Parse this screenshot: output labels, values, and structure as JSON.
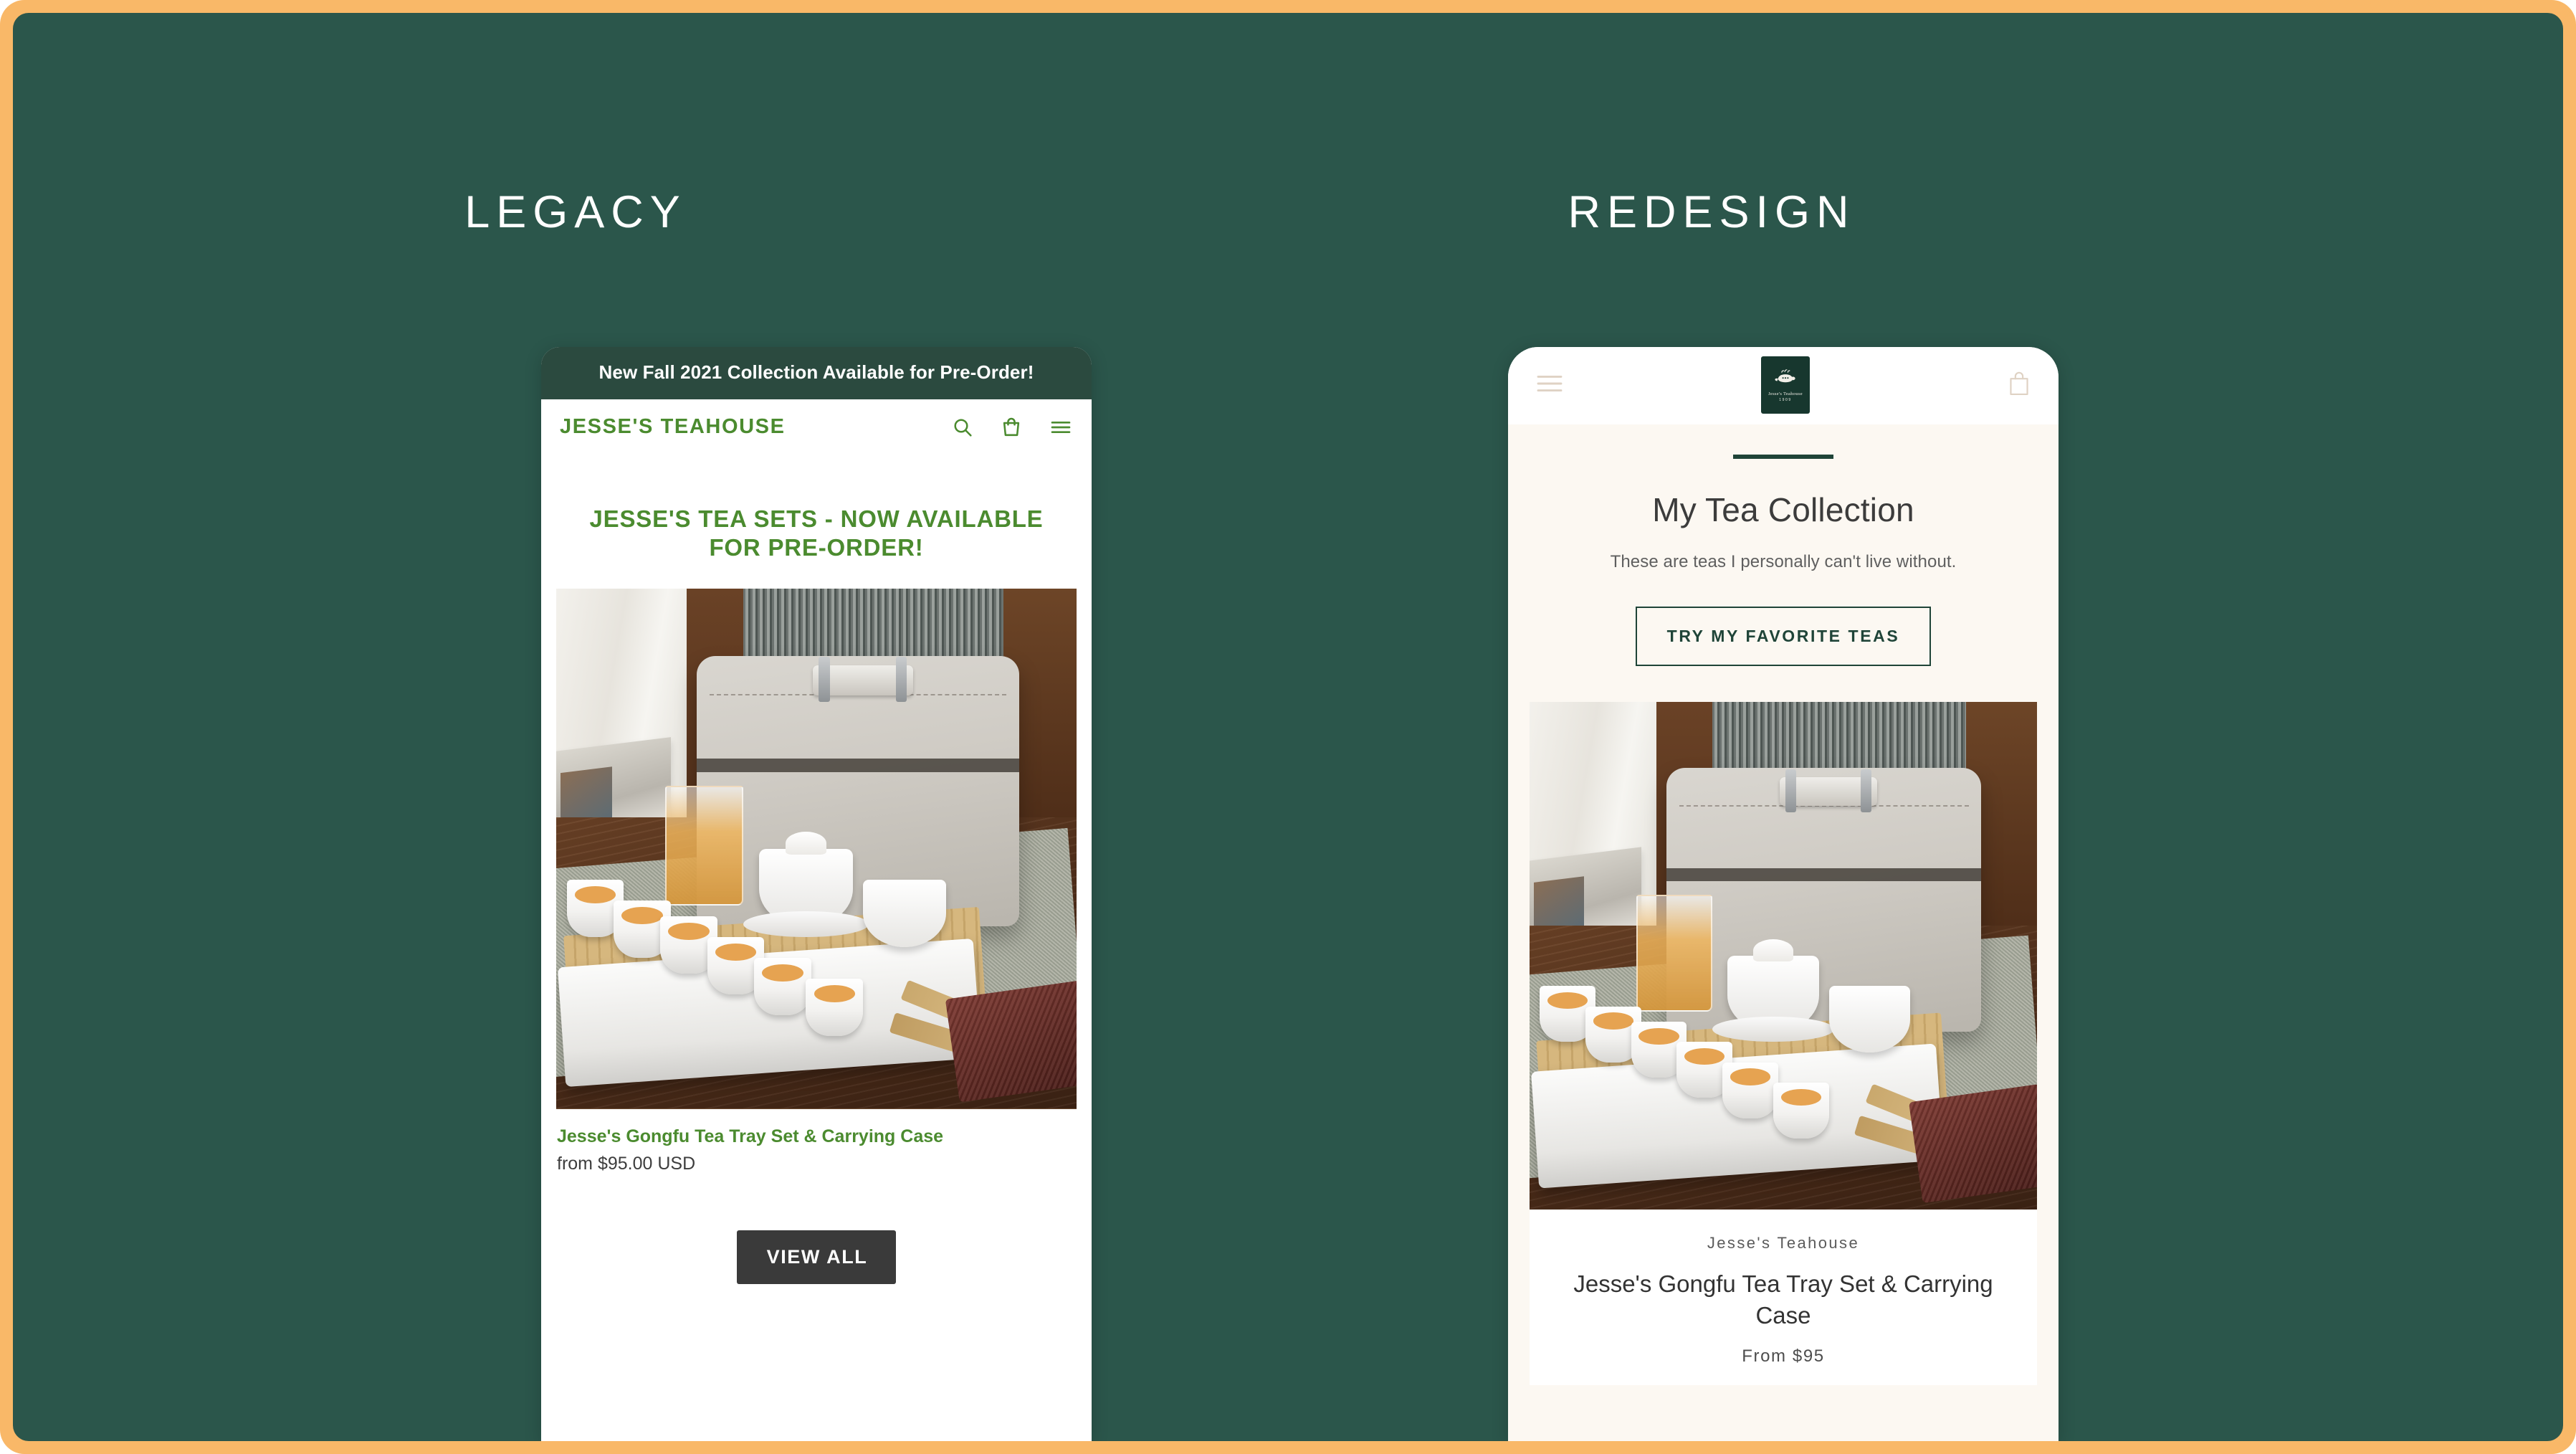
{
  "theme": {
    "frame_orange": "#f9b868",
    "stage_green": "#2b564b",
    "legacy_green": "#4b8b2f",
    "legacy_banner_green": "#2b4a3f",
    "redesign_green": "#1f4438",
    "redesign_cream": "#fcf8f2",
    "redesign_tan": "#dfd2c4"
  },
  "columns": {
    "legacy_label": "LEGACY",
    "redesign_label": "REDESIGN"
  },
  "legacy": {
    "announcement_bar": "New Fall 2021 Collection Available for Pre-Order!",
    "logo": "JESSE'S TEAHOUSE",
    "icons": [
      "search-icon",
      "shopping-bag-icon",
      "hamburger-menu-icon"
    ],
    "hero_heading": "JESSE'S TEA SETS - NOW AVAILABLE FOR PRE-ORDER!",
    "product": {
      "title": "Jesse's Gongfu Tea Tray Set & Carrying Case",
      "price": "from $95.00 USD",
      "image_alt": "gongfu-tea-tray-set-photo"
    },
    "view_all_label": "VIEW ALL"
  },
  "redesign": {
    "icons": [
      "hamburger-menu-icon",
      "brand-logo",
      "shopping-bag-icon"
    ],
    "logo_badge": {
      "wordmark": "Jesse's Teahouse",
      "established": "1909",
      "icon": "teapot-icon"
    },
    "section_title": "My Tea Collection",
    "section_subtitle": "These are teas I personally can't live without.",
    "cta_label": "TRY MY FAVORITE TEAS",
    "product": {
      "vendor": "Jesse's Teahouse",
      "title": "Jesse's Gongfu Tea Tray Set & Carrying Case",
      "price": "From $95",
      "image_alt": "gongfu-tea-tray-set-photo"
    }
  }
}
